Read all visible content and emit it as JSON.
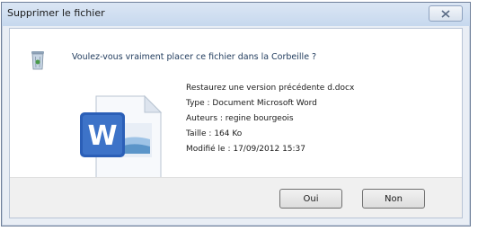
{
  "dialog": {
    "title": "Supprimer le fichier",
    "question": "Voulez-vous vraiment placer ce fichier dans la Corbeille ?"
  },
  "file": {
    "name": "Restaurez une version précédente d.docx",
    "type": "Type : Document Microsoft Word",
    "authors": "Auteurs : regine bourgeois",
    "size": "Taille : 164 Ko",
    "modified": "Modifié le : 17/09/2012 15:37"
  },
  "buttons": {
    "yes": "Oui",
    "no": "Non"
  },
  "icons": {
    "close": "close-icon",
    "recycle_bin": "recycle-bin-icon",
    "file": "word-document-icon"
  },
  "colors": {
    "title_bar": "#c6d8ee",
    "question_text": "#1e395b",
    "word_blue": "#2b5fb7"
  }
}
